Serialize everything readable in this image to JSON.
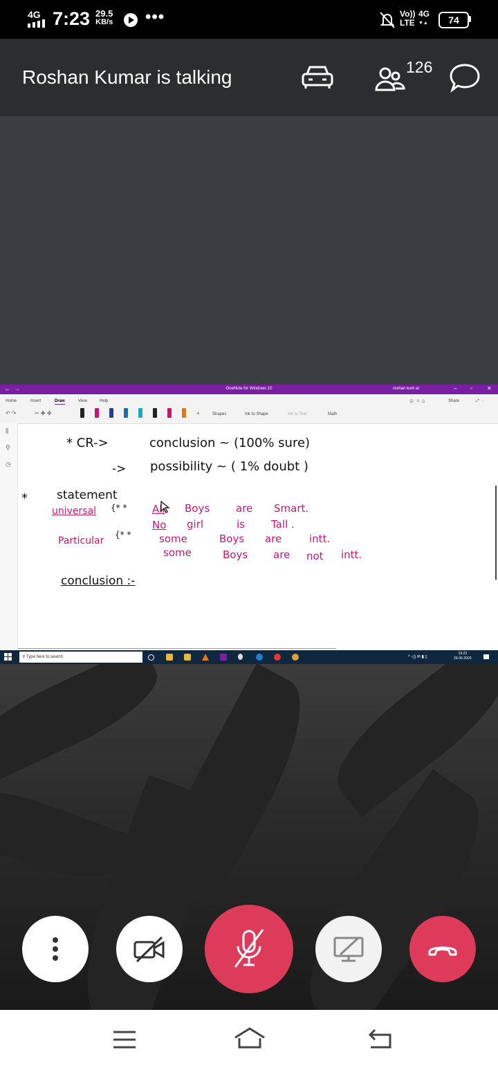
{
  "status_bar": {
    "network_type": "4G",
    "time": "7:23",
    "speed_value": "29.5",
    "speed_unit": "KB/s",
    "more": "•••",
    "volte_top": "Vo))",
    "volte_bottom": "LTE",
    "network_4g_top": "4G",
    "network_4g_bottom": "▼▲",
    "battery": "74"
  },
  "call_header": {
    "title": "Roshan Kumar is talking",
    "participant_count": "126"
  },
  "shared_screen": {
    "window_title": "OneNote for Windows 10",
    "user_name": "roshan kum ar",
    "ribbon_tabs": [
      "Home",
      "Insert",
      "Draw",
      "View",
      "Help"
    ],
    "active_tab": "Draw",
    "share_label": "Share",
    "ribbon_tools": {
      "shapes": "Shapes",
      "ink_to_shape": "Ink to Shape",
      "ink_to_text": "Ink to Text",
      "math": "Math"
    },
    "ink_lines": {
      "cr": "* CR->",
      "conclusion_def": "conclusion ~ (100% sure)",
      "arrow": "->",
      "possibility_def": "possibility ~ ( 1% doubt )",
      "star": "*",
      "statement": "statement",
      "universal": "universal",
      "particular": "Particular",
      "brace_stars_1": "{* *",
      "brace_stars_2": "{* *",
      "s1_a": "All",
      "s1_b": "Boys",
      "s1_c": "are",
      "s1_d": "Smart.",
      "s2_a": "No",
      "s2_b": "girl",
      "s2_c": "is",
      "s2_d": "Tall .",
      "s3_a": "some",
      "s3_b": "Boys",
      "s3_c": "are",
      "s3_d": "intt.",
      "s4_a": "some",
      "s4_b": "Boys",
      "s4_c": "are",
      "s4_d": "not",
      "s4_e": "intt.",
      "conclusion_heading": "conclusion :-"
    },
    "taskbar": {
      "search_placeholder": "Type here to search",
      "time": "19:23",
      "date": "26-06-2020"
    }
  },
  "colors": {
    "status_bar_bg": "#000000",
    "header_bg": "#2b2d30",
    "video_bg": "#3a3d42",
    "onenote_purple": "#7a1fa2",
    "ink_magenta": "#c4176f",
    "end_call_red": "#de3b5a"
  },
  "icons": {
    "car": "car-icon",
    "participants": "participants-icon",
    "chat": "chat-icon",
    "more": "more-options-icon",
    "camera": "camera-off-icon",
    "mic": "mic-off-icon",
    "screen_share": "screen-share-icon",
    "end_call": "end-call-icon"
  }
}
